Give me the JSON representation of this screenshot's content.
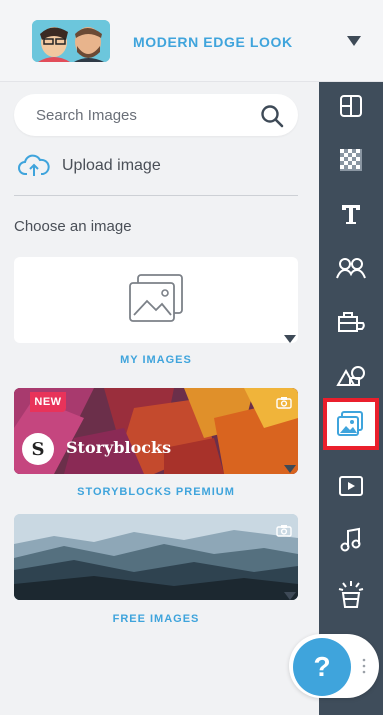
{
  "header": {
    "theme_name": "MODERN EDGE LOOK"
  },
  "search": {
    "placeholder": "Search Images"
  },
  "upload": {
    "label": "Upload image"
  },
  "section": {
    "choose_label": "Choose an image"
  },
  "tiles": [
    {
      "label": "MY IMAGES"
    },
    {
      "label": "STORYBLOCKS PREMIUM",
      "badge": "NEW",
      "brand": "Storyblocks"
    },
    {
      "label": "FREE IMAGES"
    }
  ],
  "toolbar": {
    "items": [
      {
        "icon": "layout-icon"
      },
      {
        "icon": "background-pattern-icon"
      },
      {
        "icon": "text-icon"
      },
      {
        "icon": "characters-icon"
      },
      {
        "icon": "props-icon"
      },
      {
        "icon": "shapes-icon"
      },
      {
        "icon": "images-icon",
        "selected": true
      },
      {
        "icon": "video-icon"
      },
      {
        "icon": "music-icon"
      },
      {
        "icon": "effects-icon"
      }
    ]
  },
  "help": {
    "label": "?"
  },
  "colors": {
    "accent": "#3fa4dc",
    "toolbar_bg": "#3f4d5b",
    "highlight": "#ea1f2c",
    "badge": "#e8335a"
  }
}
